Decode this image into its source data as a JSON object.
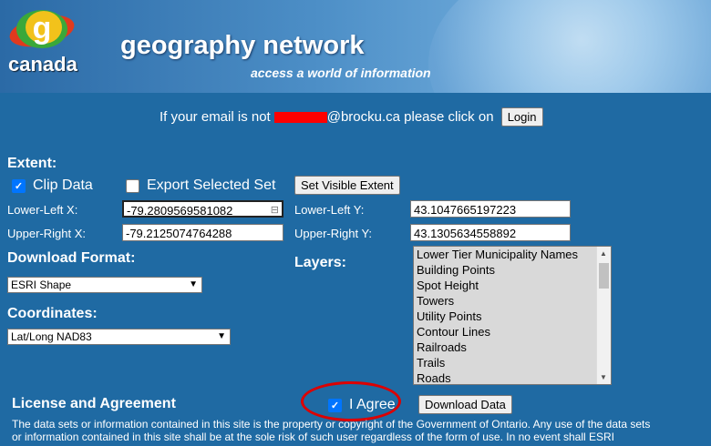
{
  "banner": {
    "logo_letter": "g",
    "logo_text": "canada",
    "brand": "geography network",
    "tagline": "access a world of information"
  },
  "login_line": {
    "prefix": "If your email is not",
    "suffix": "@brocku.ca please click on",
    "button": "Login"
  },
  "extent": {
    "heading": "Extent:",
    "clip_label": "Clip Data",
    "clip_checked": true,
    "export_label": "Export Selected Set",
    "export_checked": false,
    "set_visible_button": "Set Visible Extent",
    "lower_left_x_label": "Lower-Left X:",
    "lower_left_x": "-79.2809569581082",
    "upper_right_x_label": "Upper-Right X:",
    "upper_right_x": "-79.2125074764288",
    "lower_left_y_label": "Lower-Left Y:",
    "lower_left_y": "43.1047665197223",
    "upper_right_y_label": "Upper-Right Y:",
    "upper_right_y": "43.1305634558892"
  },
  "download_format": {
    "heading": "Download Format:",
    "selected": "ESRI Shape"
  },
  "coordinates": {
    "heading": "Coordinates:",
    "selected": "Lat/Long NAD83"
  },
  "layers": {
    "heading": "Layers:",
    "items": [
      "Lower Tier Municipality Names",
      "Building Points",
      "Spot Height",
      "Towers",
      "Utility Points",
      "Contour Lines",
      "Railroads",
      "Trails",
      "Roads"
    ]
  },
  "license": {
    "heading": "License and Agreement",
    "agree_label": "I Agree",
    "agree_checked": true,
    "download_button": "Download Data",
    "line1": "The data sets or information contained in this site is the property or copyright of the Government of Ontario. Any use of the data sets",
    "line2": "or information contained in this site shall be at the sole risk of such user regardless of the form of use. In no event shall ESRI"
  },
  "colors": {
    "background": "#1f6aa3",
    "annotation": "#dd0000",
    "redaction": "#ff0000"
  }
}
